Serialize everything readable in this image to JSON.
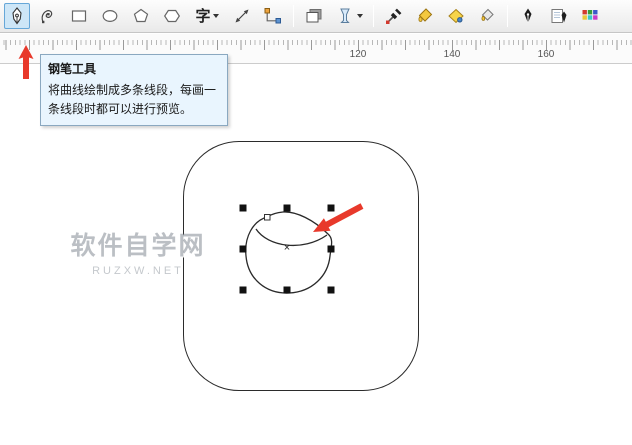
{
  "toolbar": {
    "selected_tool": "pen-tool",
    "text_tool_label": "字",
    "tools": [
      "pen-tool",
      "bspline-tool",
      "rectangle-tool",
      "ellipse-tool",
      "polygon-tool",
      "basic-shapes-tool",
      "text-tool",
      "dimension-tool",
      "connector-tool",
      "drop-shadow-tool",
      "transparency-tool",
      "eyedropper-tool",
      "paint-bucket-tool",
      "smart-fill-tool",
      "fill-tool",
      "outline-pen-tool",
      "outline-tool",
      "color-palette-tool"
    ]
  },
  "ruler": {
    "labels": [
      "120",
      "140",
      "160"
    ]
  },
  "tooltip": {
    "title": "钢笔工具",
    "body": "将曲线绘制成多条线段，每画一条线段时都可以进行预览。"
  },
  "canvas": {
    "center_marker": "×"
  },
  "watermark": {
    "title": "软件自学网",
    "subtitle": "RUZXW.NET"
  },
  "colors": {
    "annotation_arrow": "#e8392b",
    "tool_highlight_bg": "#cde6f7",
    "tool_highlight_border": "#66a7d8",
    "tooltip_bg": "#e9f5fe"
  }
}
